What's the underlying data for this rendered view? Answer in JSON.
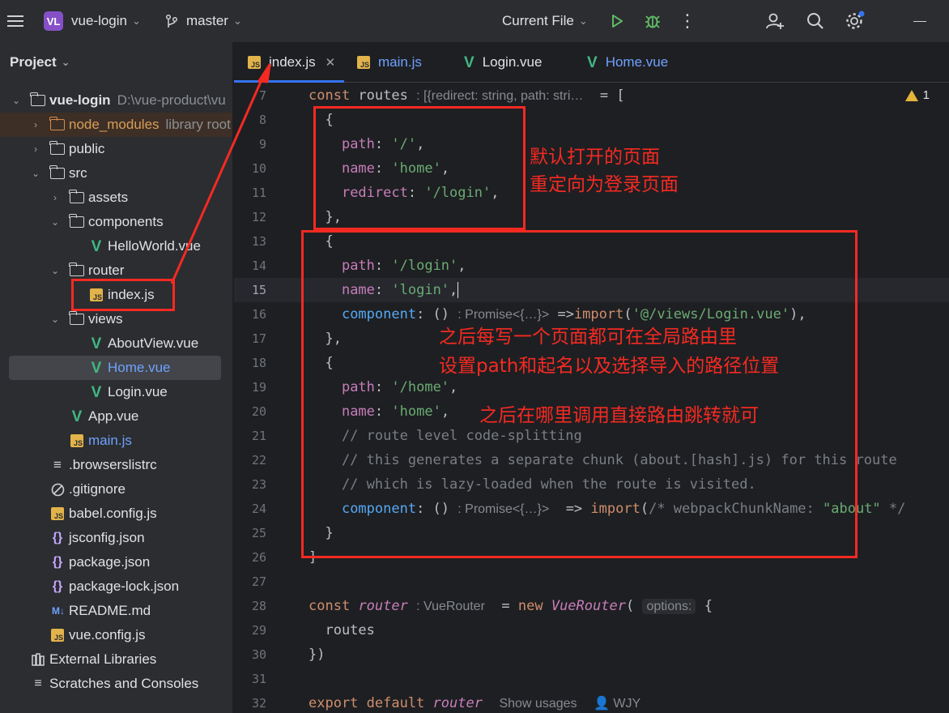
{
  "titlebar": {
    "project_badge": "VL",
    "project_name": "vue-login",
    "branch": "master",
    "run_config": "Current File"
  },
  "sidebar": {
    "title": "Project",
    "root": {
      "name": "vue-login",
      "path": "D:\\vue-product\\vu"
    },
    "node_modules": {
      "name": "node_modules",
      "hint": "library root"
    },
    "items": [
      "public",
      "src",
      "assets",
      "components",
      "HelloWorld.vue",
      "router",
      "index.js",
      "views",
      "AboutView.vue",
      "Home.vue",
      "Login.vue",
      "App.vue",
      "main.js",
      ".browserslistrc",
      ".gitignore",
      "babel.config.js",
      "jsconfig.json",
      "package.json",
      "package-lock.json",
      "README.md",
      "vue.config.js",
      "External Libraries",
      "Scratches and Consoles"
    ]
  },
  "tabs": [
    {
      "label": "index.js",
      "type": "js",
      "active": true
    },
    {
      "label": "main.js",
      "type": "js",
      "active": false
    },
    {
      "label": "Login.vue",
      "type": "vue",
      "active": false
    },
    {
      "label": "Home.vue",
      "type": "vue",
      "active": false
    }
  ],
  "editor": {
    "line_numbers": [
      "7",
      "8",
      "9",
      "10",
      "11",
      "12",
      "13",
      "14",
      "15",
      "16",
      "17",
      "18",
      "19",
      "20",
      "21",
      "22",
      "23",
      "24",
      "25",
      "26",
      "27",
      "28",
      "29",
      "30",
      "31",
      "32"
    ],
    "current_line": "15",
    "warning_count": "1",
    "hints": {
      "routes_type": ": [{redirect: string, path: stri…",
      "promise": ": Promise<{…}>",
      "router_type": ": VueRouter",
      "options": "options:",
      "show_usages": "Show usages",
      "author": "WJY"
    }
  },
  "annotations": {
    "note1_line1": "默认打开的页面",
    "note1_line2": "重定向为登录页面",
    "note2_line1": "之后每写一个页面都可在全局路由里",
    "note2_line2": "设置path和起名以及选择导入的路径位置",
    "note3": "之后在哪里调用直接路由跳转就可"
  },
  "colors": {
    "background": "#1e1f22",
    "panel": "#2b2d30",
    "accent": "#3574f0",
    "annotation": "#f42a22",
    "keyword": "#cf8e6d",
    "string": "#6aab73",
    "property": "#c77dbb",
    "function": "#56a8f5"
  },
  "icons": [
    "hamburger-icon",
    "git-branch-icon",
    "run-icon",
    "debug-icon",
    "more-icon",
    "add-user-icon",
    "search-icon",
    "settings-icon",
    "minimize-icon",
    "folder-icon",
    "js-file-icon",
    "vue-file-icon",
    "json-file-icon",
    "markdown-icon",
    "warning-icon"
  ]
}
